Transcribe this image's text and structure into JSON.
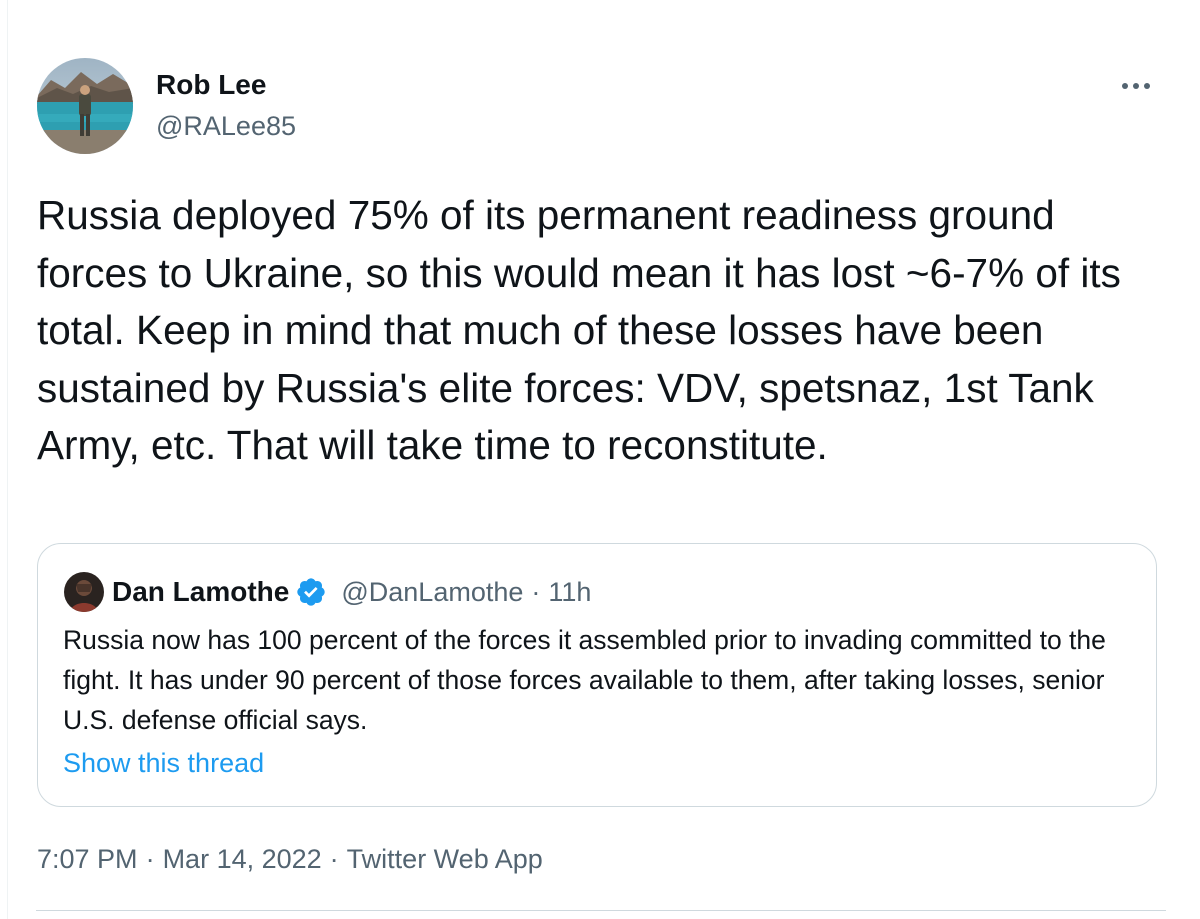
{
  "tweet": {
    "author": {
      "display_name": "Rob Lee",
      "handle": "@RALee85"
    },
    "more_icon": "more-horizontal-icon",
    "text": "Russia deployed 75% of its permanent readiness ground forces to Ukraine, so this would mean it has lost ~6-7% of its total. Keep in mind that much of these losses have been sustained by Russia's elite forces: VDV, spetsnaz, 1st Tank Army, etc. That will take time to reconstitute.",
    "quoted": {
      "display_name": "Dan Lamothe",
      "verified_icon": "verified-badge-icon",
      "handle": "@DanLamothe",
      "separator": "·",
      "time": "11h",
      "text": "Russia now has 100 percent of the forces it assembled prior to invading committed to the fight. It has under 90 percent of those forces available to them, after taking losses, senior U.S. defense official says.",
      "show_thread": "Show this thread"
    },
    "meta": {
      "time": "7:07 PM",
      "separator": "·",
      "date": "Mar 14, 2022",
      "source": "Twitter Web App"
    }
  },
  "colors": {
    "text_primary": "#0f1419",
    "text_secondary": "#536471",
    "link": "#1d9bf0",
    "border": "#cfd9de",
    "verified": "#1d9bf0"
  }
}
